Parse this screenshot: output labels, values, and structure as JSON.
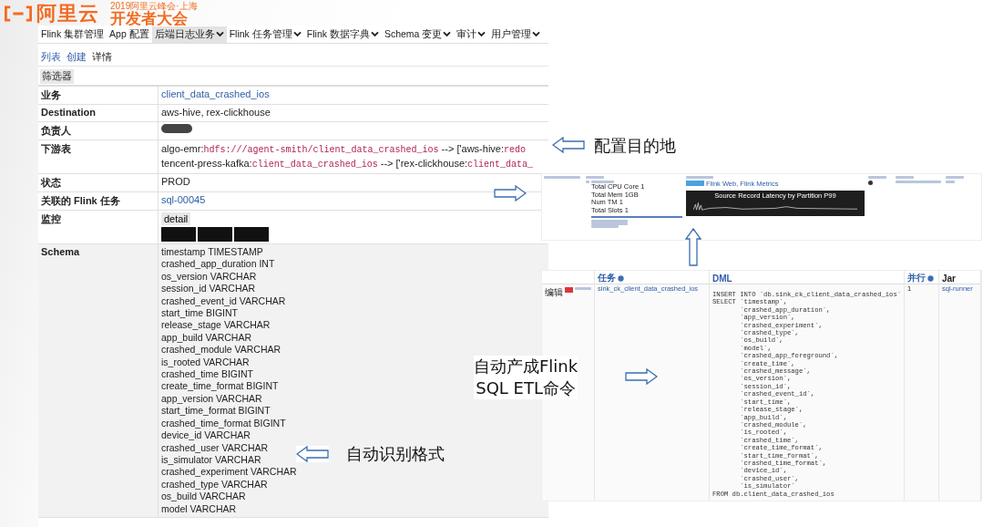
{
  "logo": {
    "brand": "阿里云",
    "event": "2019阿里云峰会·上海",
    "title": "开发者大会"
  },
  "app": {
    "nav": [
      {
        "label": "Flink 集群管理",
        "dropdown": false,
        "selected": false
      },
      {
        "label": "App 配置",
        "dropdown": false,
        "selected": false
      },
      {
        "label": "后端日志业务",
        "dropdown": true,
        "selected": true
      },
      {
        "label": "Flink 任务管理",
        "dropdown": true,
        "selected": false
      },
      {
        "label": "Flink 数据字典",
        "dropdown": true,
        "selected": false
      },
      {
        "label": "Schema 变更",
        "dropdown": true,
        "selected": false
      },
      {
        "label": "审计",
        "dropdown": true,
        "selected": false
      },
      {
        "label": "用户管理",
        "dropdown": true,
        "selected": false
      }
    ],
    "subnav": [
      {
        "label": "列表",
        "selected": false
      },
      {
        "label": "创建",
        "selected": false
      },
      {
        "label": "详情",
        "selected": true
      }
    ],
    "filter_button": "筛选器",
    "fields": [
      {
        "kind": "link",
        "label": "业务",
        "value": "client_data_crashed_ios"
      },
      {
        "kind": "text",
        "label": "Destination",
        "value": "aws-hive, rex-clickhouse"
      },
      {
        "kind": "redacted",
        "label": "负责人"
      },
      {
        "kind": "routes",
        "label": "下游表",
        "lines": [
          [
            {
              "kind": "plain",
              "text": "algo-emr:"
            },
            {
              "kind": "code",
              "text": "hdfs:///agent-smith/client_data_crashed_ios"
            },
            {
              "kind": "plain",
              "text": " --> ['aws-hive:"
            },
            {
              "kind": "code",
              "text": "redo"
            }
          ],
          [
            {
              "kind": "plain",
              "text": "tencent-press-kafka:"
            },
            {
              "kind": "code",
              "text": "client_data_crashed_ios"
            },
            {
              "kind": "plain",
              "text": " --> ['rex-clickhouse:"
            },
            {
              "kind": "code",
              "text": "client_data_"
            }
          ]
        ]
      },
      {
        "kind": "text",
        "label": "状态",
        "value": "PROD"
      },
      {
        "kind": "link",
        "label": "关联的 Flink 任务",
        "value": "sql-00045"
      },
      {
        "kind": "monitor",
        "label": "监控",
        "button": "detail"
      },
      {
        "kind": "schema",
        "label": "Schema",
        "lines": [
          "timestamp TIMESTAMP",
          "crashed_app_duration INT",
          "os_version VARCHAR",
          "session_id VARCHAR",
          "crashed_event_id VARCHAR",
          "start_time BIGINT",
          "release_stage VARCHAR",
          "app_build VARCHAR",
          "crashed_module VARCHAR",
          "is_rooted VARCHAR",
          "crashed_time BIGINT",
          "create_time_format BIGINT",
          "app_version VARCHAR",
          "start_time_format BIGINT",
          "crashed_time_format BIGINT",
          "device_id VARCHAR",
          "crashed_user VARCHAR",
          "is_simulator VARCHAR",
          "crashed_experiment VARCHAR",
          "crashed_type VARCHAR",
          "os_build VARCHAR",
          "model VARCHAR"
        ]
      }
    ]
  },
  "cluster_panel": {
    "resources": [
      "Total CPU Core 1",
      "Total Mem 1GB",
      "Num TM 1",
      "Total Slots 1"
    ],
    "links": "Flink Web, Flink Metrics",
    "chart_title": "Source Record Latency by Partition P99"
  },
  "job_panel": {
    "columns": [
      "任务",
      "DML",
      "并行",
      "Jar"
    ],
    "action": "编辑",
    "task": "sink_ck_client_data_crashed_ios",
    "parallelism": "1",
    "jar": "sql-runner",
    "dml": [
      "INSERT INTO `db.sink_ck_client_data_crashed_ios`",
      "SELECT `timestamp`,",
      "       `crashed_app_duration`,",
      "       `app_version`,",
      "       `crashed_experiment`,",
      "       `crashed_type`,",
      "       `os_build`,",
      "       `model`,",
      "       `crashed_app_foreground`,",
      "       `create_time`,",
      "       `crashed_message`,",
      "       `os_version`,",
      "       `session_id`,",
      "       `crashed_event_id`,",
      "       `start_time`,",
      "       `release_stage`,",
      "       `app_build`,",
      "       `crashed_module`,",
      "       `is_rooted`,",
      "       `crashed_time`,",
      "       `create_time_format`,",
      "       `start_time_format`,",
      "       `crashed_time_format`,",
      "       `device_id`,",
      "       `crashed_user`,",
      "       `is_simulator`",
      "FROM db.client_data_crashed_ios"
    ]
  },
  "captions": [
    "配置目的地",
    "自动产成Flink",
    "SQL ETL命令",
    "自动识别格式"
  ]
}
